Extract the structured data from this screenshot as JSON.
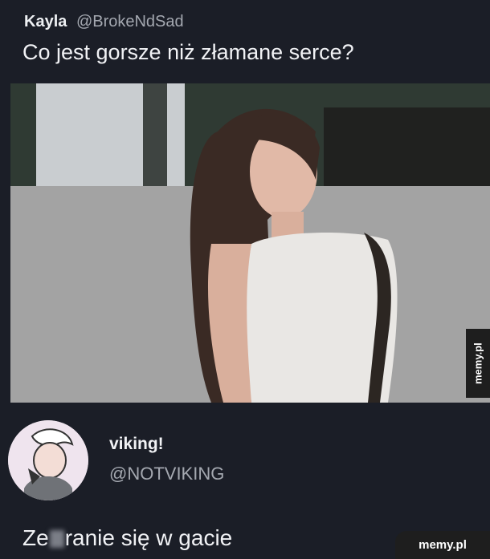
{
  "tweet": {
    "author_name": "Kayla",
    "author_handle": "@BrokeNdSad",
    "text": "Co jest gorsze niż złamane serce?"
  },
  "reply": {
    "author_name": "viking!",
    "author_handle": "@NOTVIKING",
    "text_before": "Ze",
    "text_after": "ranie się w gacie"
  },
  "watermarks": {
    "side": "memy.pl",
    "corner": "memy.pl"
  },
  "colors": {
    "background": "#1b1e27",
    "text": "#f1f2f5",
    "muted_text": "#a4a8b0"
  }
}
